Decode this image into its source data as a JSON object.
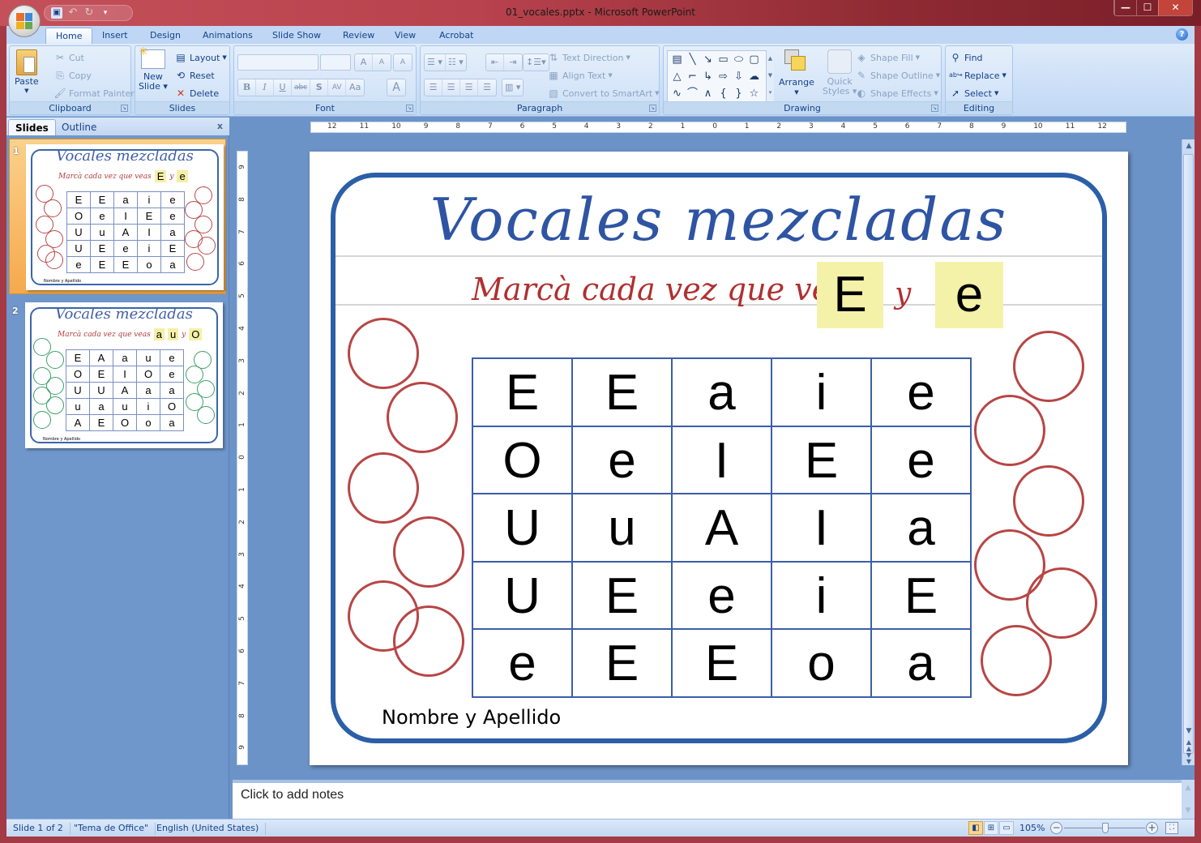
{
  "window": {
    "title": "01_vocales.pptx - Microsoft PowerPoint",
    "controls": {
      "minimize": "—",
      "maximize": "☐",
      "close": "✕"
    }
  },
  "qat": {
    "save": "save-icon",
    "undo": "undo-icon",
    "redo": "redo-icon",
    "customize": "customize-qat-icon"
  },
  "ribbon": {
    "tabs": [
      "Home",
      "Insert",
      "Design",
      "Animations",
      "Slide Show",
      "Review",
      "View",
      "Acrobat"
    ],
    "active_tab": "Home",
    "help": "?",
    "clipboard": {
      "label": "Clipboard",
      "paste": "Paste",
      "cut": "Cut",
      "copy": "Copy",
      "format_painter": "Format Painter"
    },
    "slides": {
      "label": "Slides",
      "new_slide_1": "New",
      "new_slide_2": "Slide",
      "layout": "Layout",
      "reset": "Reset",
      "delete": "Delete"
    },
    "font": {
      "label": "Font",
      "font_name": "",
      "font_size": "",
      "grow": "A",
      "shrink": "A",
      "clear": "A",
      "bold": "B",
      "italic": "I",
      "underline": "U",
      "strike": "abc",
      "shadow": "S",
      "spacing": "AV",
      "case": "Aa",
      "color": "A"
    },
    "paragraph": {
      "label": "Paragraph",
      "text_direction": "Text Direction",
      "align_text": "Align Text",
      "convert_smartart": "Convert to SmartArt"
    },
    "drawing": {
      "label": "Drawing",
      "arrange": "Arrange",
      "quick_styles_1": "Quick",
      "quick_styles_2": "Styles",
      "shape_fill": "Shape Fill",
      "shape_outline": "Shape Outline",
      "shape_effects": "Shape Effects",
      "shapes": [
        "▤",
        "╲",
        "↘",
        "▭",
        "⬭",
        "▢",
        "△",
        "⌐",
        "↳",
        "⇨",
        "⇩",
        "☁",
        "∿",
        "⌒",
        "∧",
        "{",
        "}",
        "☆"
      ]
    },
    "editing": {
      "label": "Editing",
      "find": "Find",
      "replace": "Replace",
      "select": "Select"
    }
  },
  "pane": {
    "tabs": [
      "Slides",
      "Outline"
    ],
    "active_tab": "Slides",
    "close": "x",
    "thumbnails": [
      {
        "number": "1",
        "title": "Vocales mezcladas",
        "subtitle": "Marcà cada vez que veas",
        "targets": [
          "E",
          "e"
        ],
        "conj": "y",
        "circle_color": "#b94848",
        "grid": [
          "E",
          "E",
          "a",
          "i",
          "e",
          "O",
          "e",
          "I",
          "E",
          "e",
          "U",
          "u",
          "A",
          "I",
          "a",
          "U",
          "E",
          "e",
          "i",
          "E",
          "e",
          "E",
          "E",
          "o",
          "a"
        ],
        "name_label": "Nombre y Apellido"
      },
      {
        "number": "2",
        "title": "Vocales mezcladas",
        "subtitle": "Marcà cada vez que veas",
        "targets": [
          "a",
          "u",
          "O"
        ],
        "conj": "y",
        "circle_color": "#3aa06a",
        "grid": [
          "E",
          "A",
          "a",
          "u",
          "e",
          "O",
          "E",
          "I",
          "O",
          "e",
          "U",
          "U",
          "A",
          "a",
          "a",
          "u",
          "a",
          "u",
          "i",
          "O",
          "A",
          "E",
          "O",
          "o",
          "a"
        ],
        "name_label": "Nombre y Apellido"
      }
    ]
  },
  "rulers": {
    "horizontal": [
      "12",
      "11",
      "10",
      "9",
      "8",
      "7",
      "6",
      "5",
      "4",
      "3",
      "2",
      "1",
      "0",
      "1",
      "2",
      "3",
      "4",
      "5",
      "6",
      "7",
      "8",
      "9",
      "10",
      "11",
      "12"
    ],
    "vertical": [
      "9",
      "8",
      "7",
      "6",
      "5",
      "4",
      "3",
      "2",
      "1",
      "0",
      "1",
      "2",
      "3",
      "4",
      "5",
      "6",
      "7",
      "8",
      "9"
    ]
  },
  "slide": {
    "title": "Vocales mezcladas",
    "subtitle": "Marcà cada vez que veas",
    "target_1": "E",
    "conj": "y",
    "target_2": "e",
    "grid": [
      [
        "E",
        "E",
        "a",
        "i",
        "e"
      ],
      [
        "O",
        "e",
        "I",
        "E",
        "e"
      ],
      [
        "U",
        "u",
        "A",
        "I",
        "a"
      ],
      [
        "U",
        "E",
        "e",
        "i",
        "E"
      ],
      [
        "e",
        "E",
        "E",
        "o",
        "a"
      ]
    ],
    "name_label": "Nombre y Apellido",
    "colors": {
      "frame": "#2b5fa8",
      "title": "#2e54a3",
      "subtitle": "#b03030",
      "highlight": "#f4f2a8",
      "circles": "#b84545",
      "grid_lines": "#3c5ea8"
    }
  },
  "notes": {
    "placeholder": "Click to add notes"
  },
  "status": {
    "slide": "Slide 1 of 2",
    "theme": "\"Tema de Office\"",
    "language": "English (United States)",
    "zoom": "105%",
    "zoom_level_percent": 105,
    "views": [
      "normal-view-icon",
      "slide-sorter-icon",
      "slideshow-icon"
    ]
  }
}
